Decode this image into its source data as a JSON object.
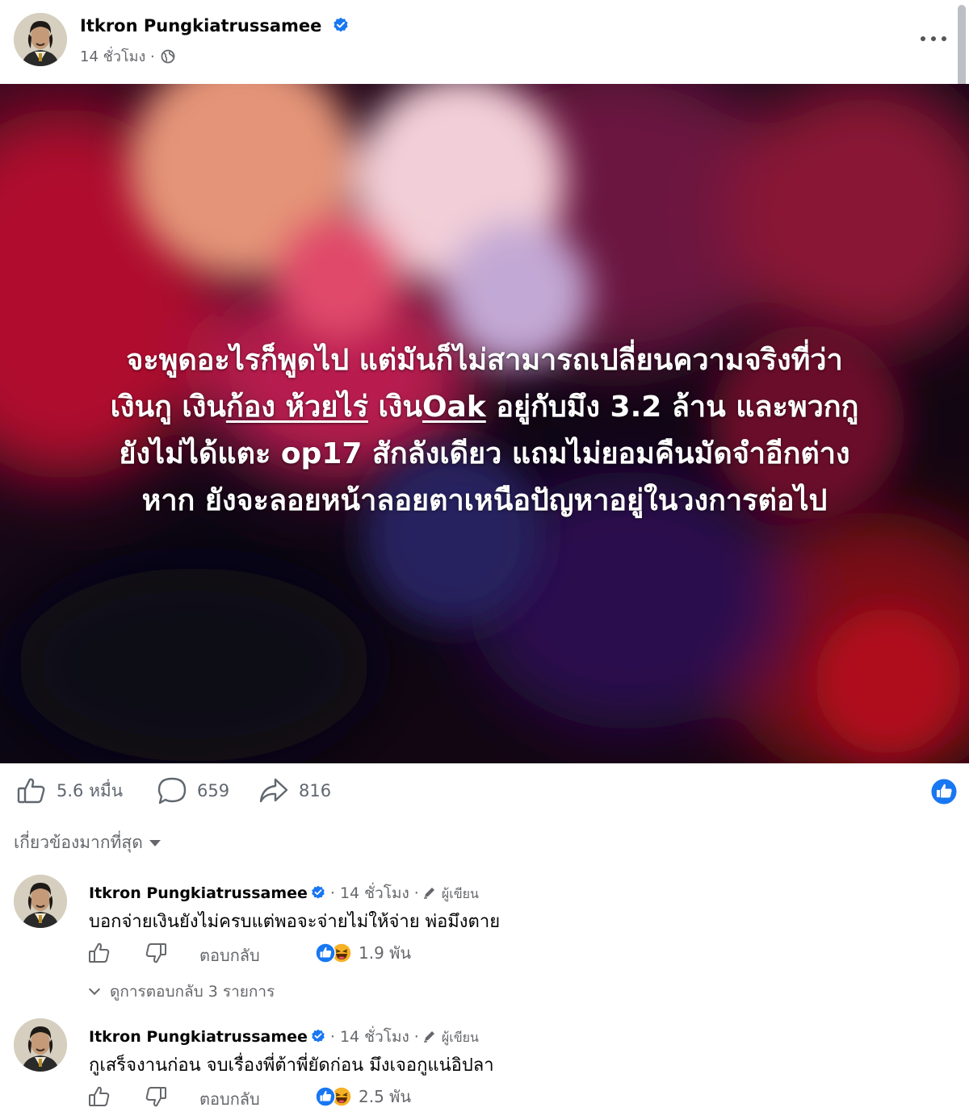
{
  "post": {
    "author": "Itkron Pungkiatrussamee",
    "time": "14 ชั่วโมง ·",
    "image_text_lines": [
      {
        "parts": [
          {
            "t": "จะพูดอะไรก็พูดไป แต่มันก็ไม่สามารถเปลี่ยนความจริงที่ว่า",
            "u": false
          }
        ]
      },
      {
        "parts": [
          {
            "t": "เงินกู เงิน",
            "u": false
          },
          {
            "t": "ก้อง ห้วยไร่",
            "u": true
          },
          {
            "t": " เงิน",
            "u": false
          },
          {
            "t": "Oak",
            "u": true
          },
          {
            "t": " อยู่กับมึง 3.2 ล้าน และพวกกู",
            "u": false
          }
        ]
      },
      {
        "parts": [
          {
            "t": "ยังไม่ได้แตะ op17 สักลังเดียว แถมไม่ยอมคืนมัดจำอีกต่าง",
            "u": false
          }
        ]
      },
      {
        "parts": [
          {
            "t": "หาก ยังจะลอยหน้าลอยตาเหนือปัญหาอยู่ในวงการต่อไป",
            "u": false
          }
        ]
      }
    ]
  },
  "actions": {
    "likes": "5.6 หมื่น",
    "comments": "659",
    "shares": "816"
  },
  "sort": {
    "label": "เกี่ยวข้องมากที่สุด"
  },
  "comments": [
    {
      "author": "Itkron Pungkiatrussamee",
      "time": "· 14 ชั่วโมง ·",
      "badge": "ผู้เขียน",
      "text": "บอกจ่ายเงินยังไม่ครบแต่พอจะจ่ายไม่ให้จ่าย พ่อมึงตาย",
      "reply_label": "ตอบกลับ",
      "reactions": "1.9 พัน",
      "view_replies": "ดูการตอบกลับ 3 รายการ"
    },
    {
      "author": "Itkron Pungkiatrussamee",
      "time": "· 14 ชั่วโมง ·",
      "badge": "ผู้เขียน",
      "text": "กูเสร็จงานก่อน จบเรื่องพี่ต้าพี่ยัดก่อน มึงเจอกูแน่อิปลา",
      "reply_label": "ตอบกลับ",
      "reactions": "2.5 พัน"
    }
  ],
  "colors": {
    "verified": "#1877f2",
    "secondary_text": "#65676b",
    "haha": "#f7b125"
  }
}
